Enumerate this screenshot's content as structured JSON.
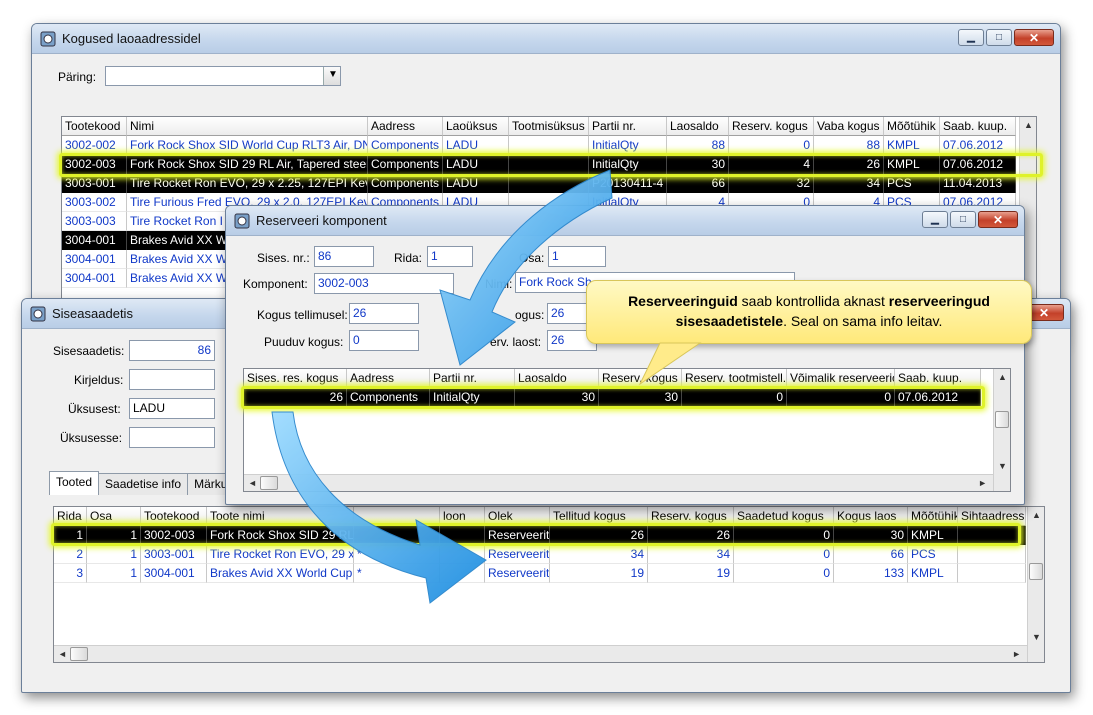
{
  "back_window": {
    "title": "Kogused laoaadressidel",
    "query_label": "Päring:",
    "query_value": "",
    "columns": [
      "Tootekood",
      "Nimi",
      "Aadress",
      "Laoüksus",
      "Tootmisüksus",
      "Partii nr.",
      "Laosaldo",
      "Reserv. kogus",
      "Vaba kogus",
      "Mõõtühik",
      "Saab. kuup."
    ],
    "rows": [
      [
        "3002-002",
        "Fork Rock Shox SID World Cup RLT3 Air, DN",
        "Components",
        "LADU",
        "",
        "InitialQty",
        "88",
        "0",
        "88",
        "KMPL",
        "07.06.2012"
      ],
      [
        "3002-003",
        "Fork Rock Shox SID 29 RL Air, Tapered steer",
        "Components",
        "LADU",
        "",
        "InitialQty",
        "30",
        "4",
        "26",
        "KMPL",
        "07.06.2012"
      ],
      [
        "3003-001",
        "Tire Rocket Ron EVO, 29 x 2.25, 127EPI Kev",
        "Components",
        "LADU",
        "",
        "P20130411-4",
        "66",
        "32",
        "34",
        "PCS",
        "11.04.2013"
      ],
      [
        "3003-002",
        "Tire Furious Fred EVO, 29 x 2.0, 127EPI Kev",
        "Components",
        "LADU",
        "",
        "InitialQty",
        "4",
        "0",
        "4",
        "PCS",
        "07.06.2012"
      ],
      [
        "3003-003",
        "Tire Rocket Ron I",
        "",
        "",
        "",
        "",
        "",
        "",
        "",
        "",
        ""
      ],
      [
        "3004-001",
        "Brakes Avid XX W",
        "",
        "",
        "",
        "",
        "",
        "",
        "",
        "",
        ""
      ],
      [
        "3004-001",
        "Brakes Avid XX W",
        "",
        "",
        "",
        "",
        "",
        "",
        "",
        "",
        ""
      ],
      [
        "3004-001",
        "Brakes Avid XX W",
        "",
        "",
        "",
        "",
        "",
        "",
        "",
        "",
        ""
      ]
    ]
  },
  "sise_window": {
    "title": "Siseasaadetis",
    "fields": {
      "sisesaadetis_label": "Sisesaadetis:",
      "sisesaadetis_value": "86",
      "kirjeldus_label": "Kirjeldus:",
      "kirjeldus_value": "",
      "uksusest_label": "Üksusest:",
      "uksusest_value": "LADU",
      "uksusesse_label": "Üksusesse:",
      "uksusesse_value": ""
    },
    "tabs": [
      "Tooted",
      "Saadetise info",
      "Märku"
    ],
    "columns": [
      "Rida",
      "Osa",
      "Tootekood",
      "Toote nimi",
      "",
      "loon",
      "Olek",
      "Tellitud kogus",
      "Reserv. kogus",
      "Saadetud kogus",
      "Kogus laos",
      "Mõõtühik",
      "Sihtaadress"
    ],
    "rows": [
      [
        "1",
        "1",
        "3002-003",
        "Fork Rock Shox SID 29 RL",
        "",
        "",
        "Reserveerit",
        "26",
        "26",
        "0",
        "30",
        "KMPL",
        ""
      ],
      [
        "2",
        "1",
        "3003-001",
        "Tire Rocket Ron EVO, 29 x",
        "*",
        "",
        "Reserveerit",
        "34",
        "34",
        "0",
        "66",
        "PCS",
        ""
      ],
      [
        "3",
        "1",
        "3004-001",
        "Brakes Avid XX World Cup,",
        "*",
        "",
        "Reserveerit",
        "19",
        "19",
        "0",
        "133",
        "KMPL",
        ""
      ]
    ]
  },
  "reserve_window": {
    "title": "Reserveeri komponent",
    "sises_nr_label": "Sises. nr.:",
    "sises_nr_value": "86",
    "rida_label": "Rida:",
    "rida_value": "1",
    "osa_label": "Osa:",
    "osa_value": "1",
    "komponent_label": "Komponent:",
    "komponent_value": "3002-003",
    "nimi_label": "Nimi:",
    "nimi_value": "Fork Rock Sh",
    "kogus_tellimusel_label": "Kogus tellimusel:",
    "kogus_tellimusel_value": "26",
    "kogus_label": "ogus:",
    "kogus_value": "26",
    "puuduv_label": "Puuduv kogus:",
    "puuduv_value": "0",
    "reserv_laost_label": "erv. laost:",
    "reserv_laost_value": "26",
    "columns": [
      "Sises. res. kogus",
      "Aadress",
      "Partii nr.",
      "Laosaldo",
      "Reserv. kogus",
      "Reserv. tootmistell.",
      "Võimalik reserveeric",
      "Saab. kuup."
    ],
    "rows": [
      [
        "26",
        "Components",
        "InitialQty",
        "30",
        "30",
        "0",
        "0",
        "07.06.2012"
      ]
    ]
  },
  "callout": {
    "bold1": "Reserveeringuid",
    "text1": " saab kontrollida aknast ",
    "bold2": "reserveeringud sisesaadetistele",
    "text2": ".  Seal on sama info leitav."
  },
  "colors": {
    "accent_blue": "#1038c8",
    "highlight": "#dff22a",
    "arrow": "#2f9fe6"
  }
}
